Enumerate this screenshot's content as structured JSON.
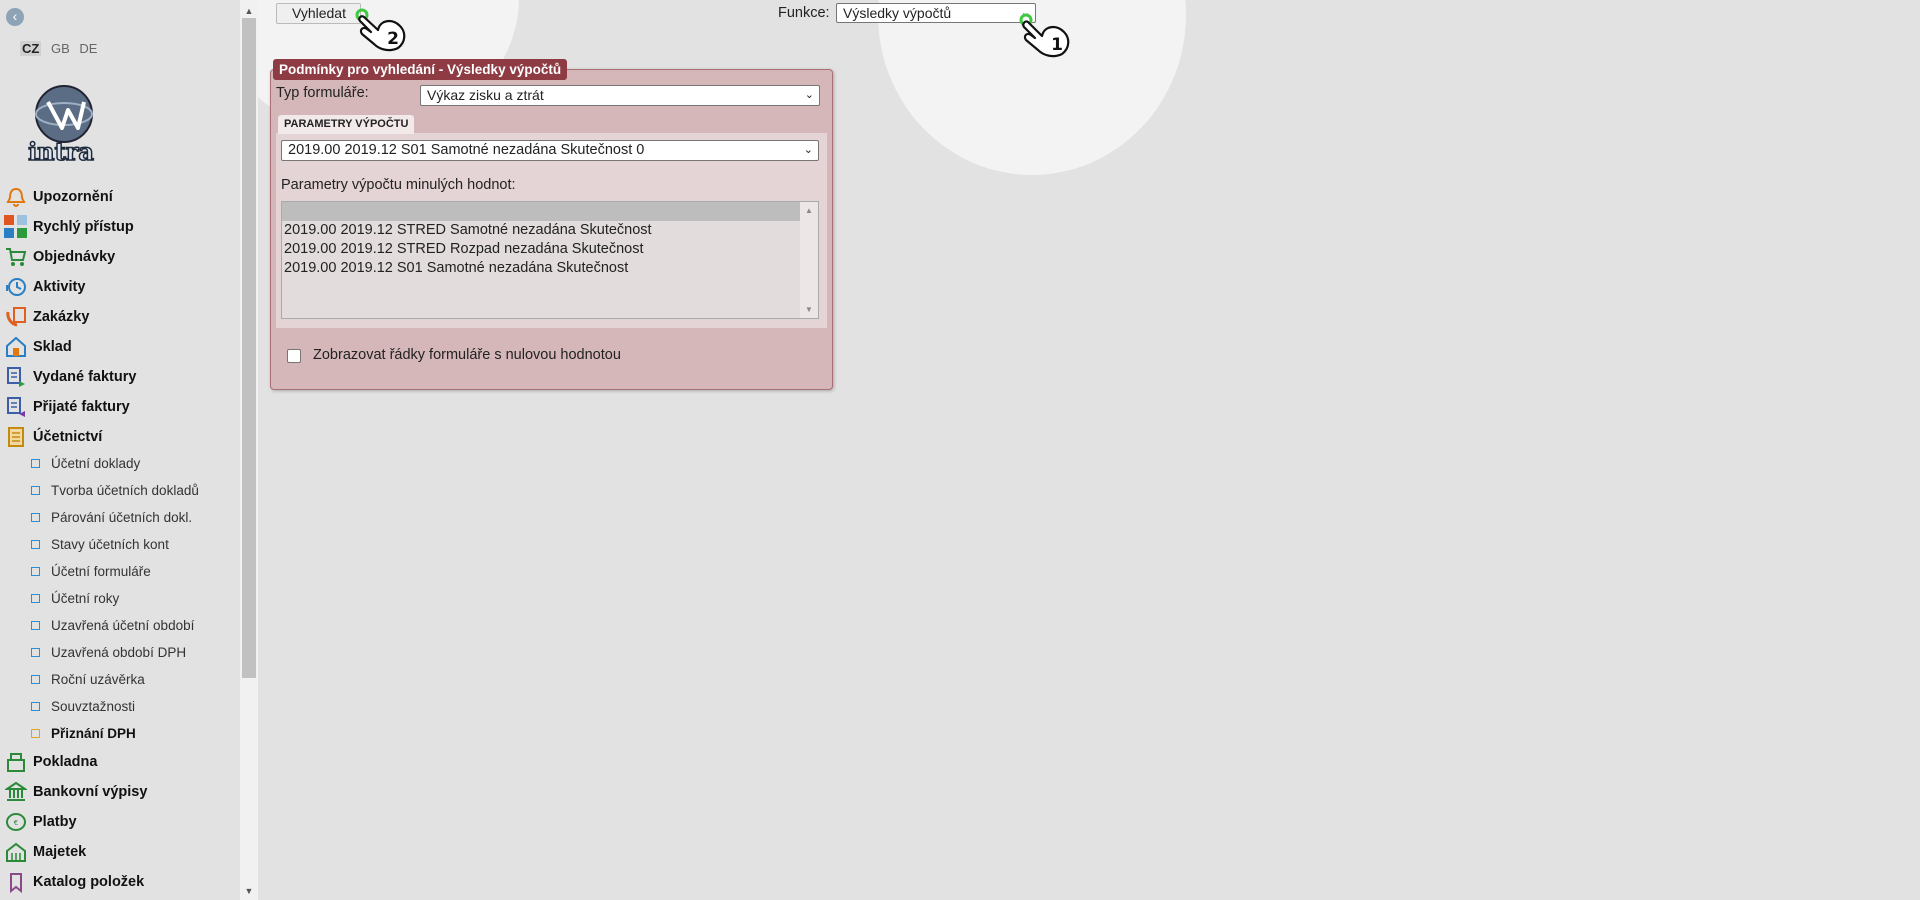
{
  "sidebar": {
    "back_icon": "chevron-left-icon",
    "languages": [
      "CZ",
      "GB",
      "DE"
    ],
    "active_language": "CZ",
    "logo_text": "intra",
    "menu": [
      {
        "label": "Upozornění",
        "icon": "alarm-bell-icon"
      },
      {
        "label": "Rychlý přístup",
        "icon": "quick-access-tiles-icon"
      },
      {
        "label": "Objednávky",
        "icon": "shopping-cart-icon"
      },
      {
        "label": "Aktivity",
        "icon": "clock-icon"
      },
      {
        "label": "Zakázky",
        "icon": "phone-order-icon"
      },
      {
        "label": "Sklad",
        "icon": "warehouse-icon"
      },
      {
        "label": "Vydané faktury",
        "icon": "invoice-out-icon"
      },
      {
        "label": "Přijaté faktury",
        "icon": "invoice-in-icon"
      },
      {
        "label": "Účetnictví",
        "icon": "ledger-icon"
      }
    ],
    "submenu": [
      {
        "label": "Účetní doklady"
      },
      {
        "label": "Tvorba účetních dokladů"
      },
      {
        "label": "Párování účetních dokl."
      },
      {
        "label": "Stavy účetních kont"
      },
      {
        "label": "Účetní formuláře"
      },
      {
        "label": "Účetní roky"
      },
      {
        "label": "Uzavřená účetní období"
      },
      {
        "label": "Uzavřená období DPH"
      },
      {
        "label": "Roční uzávěrka"
      },
      {
        "label": "Souvztažnosti"
      },
      {
        "label": "Přiznání DPH"
      }
    ],
    "menu_after": [
      {
        "label": "Pokladna",
        "icon": "cash-register-icon"
      },
      {
        "label": "Bankovní výpisy",
        "icon": "bank-icon"
      },
      {
        "label": "Platby",
        "icon": "payment-icon"
      },
      {
        "label": "Majetek",
        "icon": "property-icon"
      },
      {
        "label": "Katalog položek",
        "icon": "catalog-tag-icon"
      }
    ]
  },
  "toolbar": {
    "search_label": "Vyhledat",
    "function_label": "Funkce:",
    "function_value": "Výsledky výpočtů"
  },
  "panel": {
    "legend": "Podmínky pro vyhledání - Výsledky výpočtů",
    "form_type_label": "Typ formuláře:",
    "form_type_value": "Výkaz zisku a ztrát",
    "params_tab": "PARAMETRY VÝPOČTU",
    "calc_value": "2019.00 2019.12 S01 Samotné nezadána Skutečnost 0",
    "prev_label": "Parametry výpočtu minulých hodnot:",
    "prev_options": [
      "",
      "2019.00 2019.12 STRED Samotné nezadána Skutečnost",
      "2019.00 2019.12 STRED Rozpad nezadána Skutečnost",
      "2019.00 2019.12 S01 Samotné nezadána Skutečnost"
    ],
    "zero_rows_label": "Zobrazovat řádky formuláře s nulovou hodnotou",
    "zero_rows_checked": false
  },
  "annotations": {
    "marker_1": "1",
    "marker_2": "2"
  },
  "colors": {
    "panel_bg": "#d5b7ba",
    "legend_bg": "#8e3b44",
    "sub_square": "#2a8fd6",
    "folder": "#e0a020",
    "marker_ring": "#3ec93e"
  }
}
